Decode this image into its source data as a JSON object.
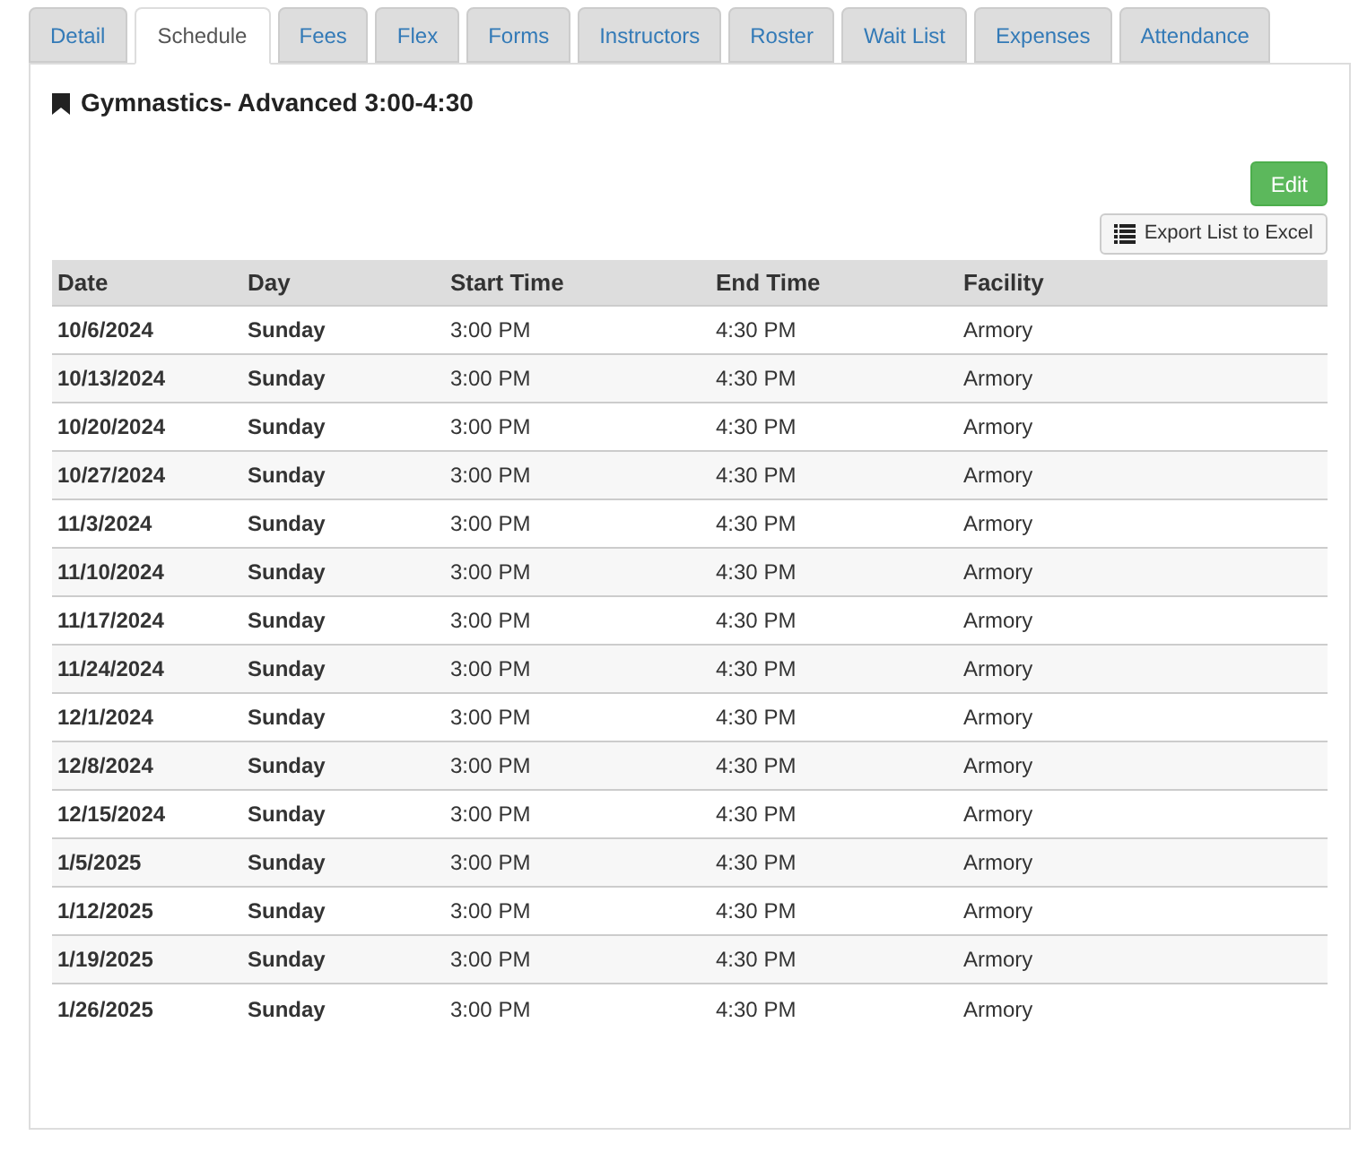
{
  "tabs": [
    {
      "label": "Detail",
      "selected": false
    },
    {
      "label": "Schedule",
      "selected": true
    },
    {
      "label": "Fees",
      "selected": false
    },
    {
      "label": "Flex",
      "selected": false
    },
    {
      "label": "Forms",
      "selected": false
    },
    {
      "label": "Instructors",
      "selected": false
    },
    {
      "label": "Roster",
      "selected": false
    },
    {
      "label": "Wait List",
      "selected": false
    },
    {
      "label": "Expenses",
      "selected": false
    },
    {
      "label": "Attendance",
      "selected": false
    }
  ],
  "title": "Gymnastics- Advanced 3:00-4:30",
  "buttons": {
    "edit": "Edit",
    "export": "Export List to Excel"
  },
  "table": {
    "columns": [
      "Date",
      "Day",
      "Start Time",
      "End Time",
      "Facility"
    ],
    "rows": [
      [
        "10/6/2024",
        "Sunday",
        "3:00 PM",
        "4:30 PM",
        "Armory"
      ],
      [
        "10/13/2024",
        "Sunday",
        "3:00 PM",
        "4:30 PM",
        "Armory"
      ],
      [
        "10/20/2024",
        "Sunday",
        "3:00 PM",
        "4:30 PM",
        "Armory"
      ],
      [
        "10/27/2024",
        "Sunday",
        "3:00 PM",
        "4:30 PM",
        "Armory"
      ],
      [
        "11/3/2024",
        "Sunday",
        "3:00 PM",
        "4:30 PM",
        "Armory"
      ],
      [
        "11/10/2024",
        "Sunday",
        "3:00 PM",
        "4:30 PM",
        "Armory"
      ],
      [
        "11/17/2024",
        "Sunday",
        "3:00 PM",
        "4:30 PM",
        "Armory"
      ],
      [
        "11/24/2024",
        "Sunday",
        "3:00 PM",
        "4:30 PM",
        "Armory"
      ],
      [
        "12/1/2024",
        "Sunday",
        "3:00 PM",
        "4:30 PM",
        "Armory"
      ],
      [
        "12/8/2024",
        "Sunday",
        "3:00 PM",
        "4:30 PM",
        "Armory"
      ],
      [
        "12/15/2024",
        "Sunday",
        "3:00 PM",
        "4:30 PM",
        "Armory"
      ],
      [
        "1/5/2025",
        "Sunday",
        "3:00 PM",
        "4:30 PM",
        "Armory"
      ],
      [
        "1/12/2025",
        "Sunday",
        "3:00 PM",
        "4:30 PM",
        "Armory"
      ],
      [
        "1/19/2025",
        "Sunday",
        "3:00 PM",
        "4:30 PM",
        "Armory"
      ],
      [
        "1/26/2025",
        "Sunday",
        "3:00 PM",
        "4:30 PM",
        "Armory"
      ]
    ]
  }
}
